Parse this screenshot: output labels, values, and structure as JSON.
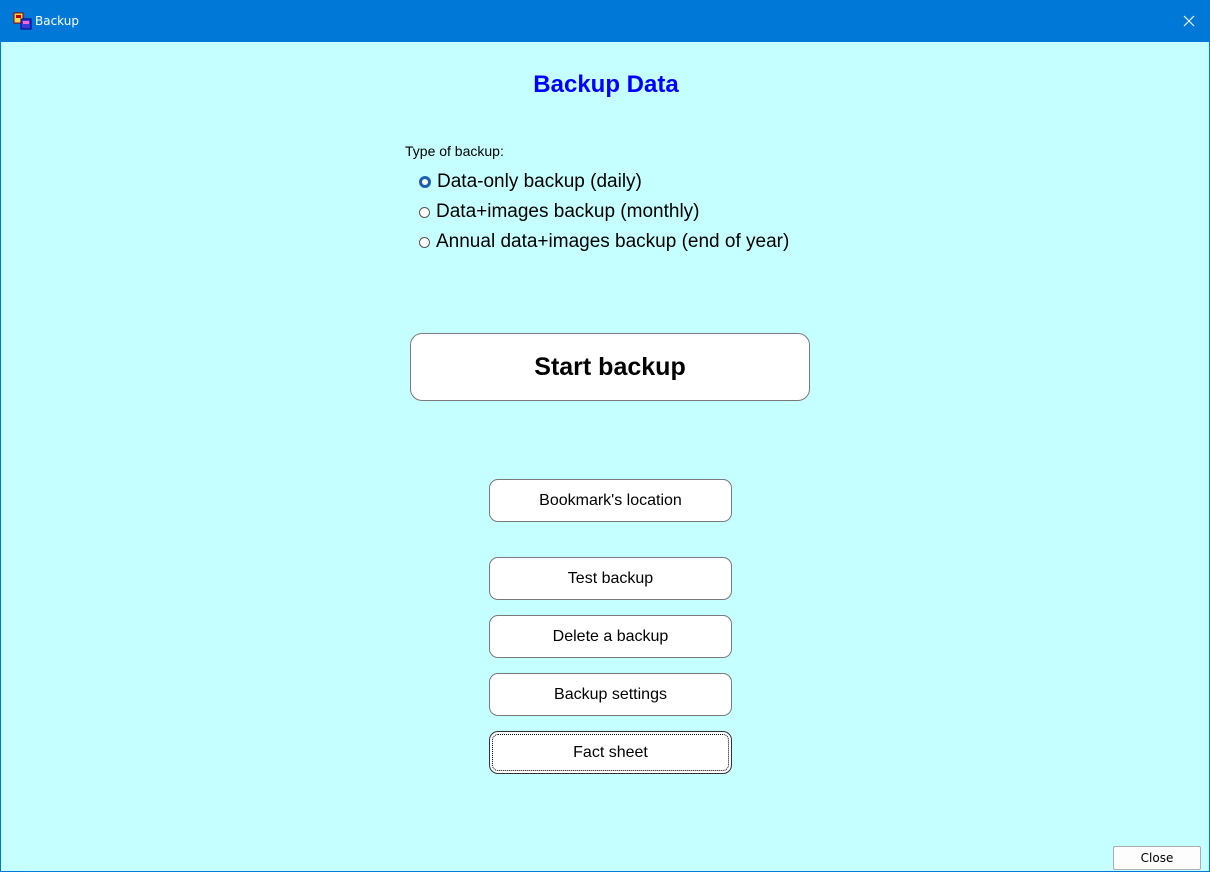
{
  "window": {
    "title": "Backup",
    "close_glyph": "✕"
  },
  "heading": "Backup Data",
  "backup_type": {
    "label": "Type of backup:",
    "options": [
      {
        "label": "Data-only backup (daily)",
        "selected": true
      },
      {
        "label": "Data+images backup (monthly)",
        "selected": false
      },
      {
        "label": "Annual data+images backup (end of year)",
        "selected": false
      }
    ]
  },
  "buttons": {
    "start_backup": "Start backup",
    "bookmarks_location": "Bookmark's location",
    "test_backup": "Test backup",
    "delete_backup": "Delete a backup",
    "backup_settings": "Backup settings",
    "fact_sheet": "Fact sheet",
    "close": "Close"
  },
  "colors": {
    "titlebar": "#0078d7",
    "background": "#c6ffff",
    "heading": "#0000ff"
  },
  "icons": {
    "app": "backup-app-icon",
    "close": "close-icon"
  }
}
